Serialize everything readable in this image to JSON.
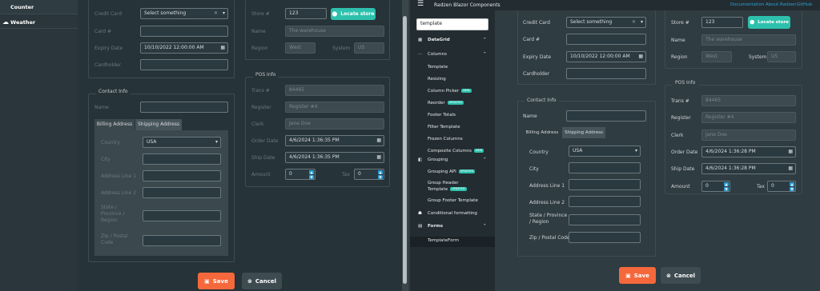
{
  "left": {
    "nav": {
      "counter": "Counter",
      "weather": "Weather"
    },
    "order": {
      "credit_card_label": "Credit Card",
      "credit_card_placeholder": "Select something",
      "card_label": "Card #",
      "expiry_label": "Expiry Date",
      "expiry_value": "10/10/2022 12:00:00 AM",
      "cardholder_label": "Cardholder",
      "store_label": "Store #",
      "store_value": "123",
      "locate_label": "Locate store",
      "name_label": "Name",
      "name_value": "The warehouse",
      "region_label": "Region",
      "region_value": "West",
      "system_label": "System",
      "system_value": "US"
    },
    "contact": {
      "title": "Contact Info",
      "name_label": "Name",
      "tab_billing": "Billing Address",
      "tab_shipping": "Shipping Address",
      "country_label": "Country",
      "country_value": "USA",
      "city_label": "City",
      "addr1_label": "Address Line 1",
      "addr2_label": "Address Line 2",
      "state_label": "State / Province / Region",
      "zip_label": "Zip / Postal Code"
    },
    "pos": {
      "title": "POS Info",
      "trans_label": "Trans #",
      "trans_value": "84465",
      "register_label": "Register",
      "register_value": "Register #4",
      "clerk_label": "Clerk",
      "clerk_value": "Jane Doe",
      "order_date_label": "Order Date",
      "order_date_value": "4/6/2024 1:36:35 PM",
      "ship_date_label": "Ship Date",
      "ship_date_value": "4/6/2024 1:36:35 PM",
      "amount_label": "Amount",
      "amount_value": "0",
      "tax_label": "Tax",
      "tax_value": "0"
    },
    "save": "Save",
    "cancel": "Cancel"
  },
  "right": {
    "header": {
      "title": "Radzen Blazor Components",
      "documentation": "Documentation",
      "about": "About Radzen",
      "github": "GitHub"
    },
    "search_value": "template",
    "sidebar": {
      "datagrid": "DataGrid",
      "columns": "Columns",
      "column_items": [
        {
          "label": "Template",
          "badge": ""
        },
        {
          "label": "Resizing",
          "badge": ""
        },
        {
          "label": "Column Picker",
          "badge": "NEW"
        },
        {
          "label": "Reorder",
          "badge": "UPDATED"
        },
        {
          "label": "Footer Totals",
          "badge": ""
        },
        {
          "label": "Filter Template",
          "badge": ""
        },
        {
          "label": "Frozen Columns",
          "badge": ""
        },
        {
          "label": "Composite Columns",
          "badge": "NEW"
        }
      ],
      "grouping": "Grouping",
      "grouping_items": [
        {
          "label": "Grouping API",
          "badge": "UPDATED"
        },
        {
          "label": "Group Header Template",
          "badge": "UPDATED"
        },
        {
          "label": "Group Footer Template",
          "badge": ""
        }
      ],
      "conditional": "Conditional formatting",
      "forms": "Forms",
      "template_form": "TemplateForm"
    },
    "order": {
      "credit_card_label": "Credit Card",
      "credit_card_placeholder": "Select something",
      "card_label": "Card #",
      "expiry_label": "Expiry Date",
      "expiry_value": "10/10/2022 12:00:00 AM",
      "cardholder_label": "Cardholder",
      "store_label": "Store #",
      "store_value": "123",
      "locate_label": "Locate store",
      "name_label": "Name",
      "name_value": "The warehouse",
      "region_label": "Region",
      "region_value": "West",
      "system_label": "System",
      "system_value": "US"
    },
    "contact": {
      "title": "Contact Info",
      "name_label": "Name",
      "tab_billing": "Billing Address",
      "tab_shipping": "Shipping Address",
      "country_label": "Country",
      "country_value": "USA",
      "city_label": "City",
      "addr1_label": "Address Line 1",
      "addr2_label": "Address Line 2",
      "state_label": "State / Province / Region",
      "zip_label": "Zip / Postal Code"
    },
    "pos": {
      "title": "POS Info",
      "trans_label": "Trans #",
      "trans_value": "84465",
      "register_label": "Register",
      "register_value": "Register #4",
      "clerk_label": "Clerk",
      "clerk_value": "Jane Doe",
      "order_date_label": "Order Date",
      "order_date_value": "4/6/2024 1:36:28 PM",
      "ship_date_label": "Ship Date",
      "ship_date_value": "4/6/2024 1:36:28 PM",
      "amount_label": "Amount",
      "amount_value": "0",
      "tax_label": "Tax",
      "tax_value": "0"
    },
    "save": "Save",
    "cancel": "Cancel"
  },
  "colors": {
    "background": "#2f3c42",
    "sidebar": "#232d31",
    "accent": "#2dc1ad",
    "save": "#f4683c",
    "cancel": "#3e4b51",
    "link": "#2b9fd8"
  }
}
